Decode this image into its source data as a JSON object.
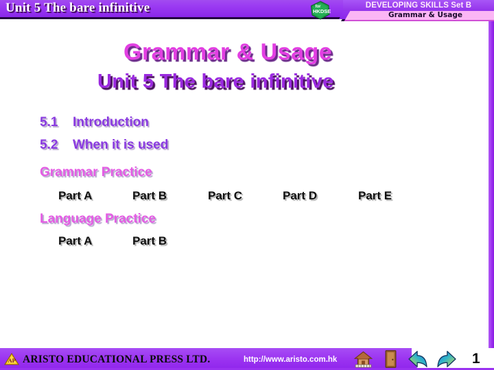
{
  "header": {
    "unit_title": "Unit 5 The bare infinitive",
    "series_title": "DEVELOPING SKILLS Set B",
    "subtitle": "Grammar & Usage",
    "badge_line1": "for",
    "badge_line2": "HKDSE",
    "badge_name": "hkdse-badge",
    "colors": {
      "bar_purple": "#9b3bf2",
      "pink_band": "#fbb6f5",
      "badge_green": "#1f9d4a"
    }
  },
  "main": {
    "title": "Grammar & Usage",
    "subtitle": "Unit 5 The bare infinitive",
    "title_color": "#e23fe2",
    "subtitle_color": "#9b2ae0",
    "sections": [
      {
        "number": "5.1",
        "label": "Introduction"
      },
      {
        "number": "5.2",
        "label": "When it is used"
      }
    ],
    "practice_groups": [
      {
        "heading": "Grammar Practice",
        "parts": [
          "Part A",
          "Part B",
          "Part C",
          "Part D",
          "Part E"
        ]
      },
      {
        "heading": "Language Practice",
        "parts": [
          "Part A",
          "Part B"
        ]
      }
    ]
  },
  "footer": {
    "publisher": "ARISTO EDUCATIONAL PRESS LTD.",
    "url": "http://www.aristo.com.hk",
    "page_number": "1",
    "logo_letters": "AP",
    "nav_icons": [
      {
        "name": "home-icon",
        "label": "Home"
      },
      {
        "name": "exit-door-icon",
        "label": "Exit"
      },
      {
        "name": "previous-arrow-icon",
        "label": "Previous"
      },
      {
        "name": "next-arrow-icon",
        "label": "Next"
      }
    ]
  }
}
